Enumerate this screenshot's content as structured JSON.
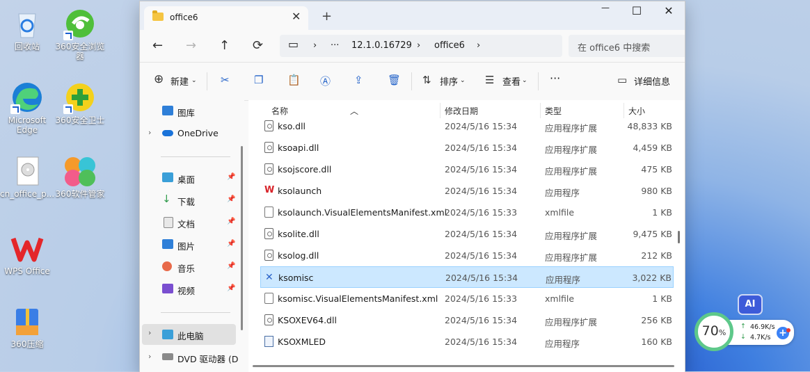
{
  "desktop": {
    "icons": [
      {
        "label": "回收站"
      },
      {
        "label": "360安全浏览器"
      },
      {
        "label": "Microsoft Edge"
      },
      {
        "label": "360安全卫士"
      },
      {
        "label": "cn_office_p..."
      },
      {
        "label": "360软件管家"
      },
      {
        "label": "WPS Office"
      },
      {
        "label": "360压缩"
      }
    ]
  },
  "window": {
    "tab_title": "office6",
    "close_tab": "✕",
    "new_tab": "+",
    "minimize": "—",
    "maximize": "☐",
    "close": "✕",
    "nav": {
      "back": "←",
      "forward": "→",
      "up": "↑",
      "refresh": "⟳"
    },
    "address": {
      "computer_glyph": "▭",
      "sep": "›",
      "ellipsis": "···",
      "crumbs": [
        "12.1.0.16729",
        "office6"
      ]
    },
    "search_placeholder": "在 office6 中搜索",
    "toolbar": {
      "new_label": "新建",
      "sort_label": "排序",
      "view_label": "查看",
      "more": "···",
      "details_label": "详细信息"
    },
    "navpane": {
      "items": [
        {
          "label": "图库",
          "pinned": false
        },
        {
          "label": "OneDrive",
          "pinned": false
        },
        {
          "label": "桌面",
          "pinned": true
        },
        {
          "label": "下载",
          "pinned": true
        },
        {
          "label": "文档",
          "pinned": true
        },
        {
          "label": "图片",
          "pinned": true
        },
        {
          "label": "音乐",
          "pinned": true
        },
        {
          "label": "视频",
          "pinned": true
        },
        {
          "label": "此电脑",
          "pinned": false
        },
        {
          "label": "DVD 驱动器 (D",
          "pinned": false
        }
      ]
    },
    "columns": [
      "名称",
      "修改日期",
      "类型",
      "大小"
    ],
    "files": [
      {
        "name": "kso.dll",
        "date": "2024/5/16 15:34",
        "type": "应用程序扩展",
        "size": "48,833 KB",
        "icon": "dll"
      },
      {
        "name": "ksoapi.dll",
        "date": "2024/5/16 15:34",
        "type": "应用程序扩展",
        "size": "4,459 KB",
        "icon": "dll"
      },
      {
        "name": "ksojscore.dll",
        "date": "2024/5/16 15:34",
        "type": "应用程序扩展",
        "size": "475 KB",
        "icon": "dll"
      },
      {
        "name": "ksolaunch",
        "date": "2024/5/16 15:34",
        "type": "应用程序",
        "size": "980 KB",
        "icon": "wps"
      },
      {
        "name": "ksolaunch.VisualElementsManifest.xml",
        "date": "2024/5/16 15:33",
        "type": "xmlfile",
        "size": "1 KB",
        "icon": "doc"
      },
      {
        "name": "ksolite.dll",
        "date": "2024/5/16 15:34",
        "type": "应用程序扩展",
        "size": "9,475 KB",
        "icon": "dll"
      },
      {
        "name": "ksolog.dll",
        "date": "2024/5/16 15:34",
        "type": "应用程序扩展",
        "size": "212 KB",
        "icon": "dll"
      },
      {
        "name": "ksomisc",
        "date": "2024/5/16 15:34",
        "type": "应用程序",
        "size": "3,022 KB",
        "icon": "tool",
        "selected": true
      },
      {
        "name": "ksomisc.VisualElementsManifest.xml",
        "date": "2024/5/16 15:33",
        "type": "xmlfile",
        "size": "1 KB",
        "icon": "doc"
      },
      {
        "name": "KSOXEV64.dll",
        "date": "2024/5/16 15:34",
        "type": "应用程序扩展",
        "size": "256 KB",
        "icon": "dll"
      },
      {
        "name": "KSOXMLED",
        "date": "2024/5/16 15:34",
        "type": "应用程序",
        "size": "160 KB",
        "icon": "exe"
      }
    ]
  },
  "widgets": {
    "ai_label": "AI",
    "ring_value": "70",
    "ring_unit": "%",
    "upload": "46.9K/s",
    "download": "4.7K/s",
    "plus": "+",
    "up_arrow": "↑",
    "down_arrow": "↓"
  },
  "colors": {
    "accent": "#2463c9",
    "selected_row": "#cce8ff",
    "ring": "#5ec88a"
  }
}
